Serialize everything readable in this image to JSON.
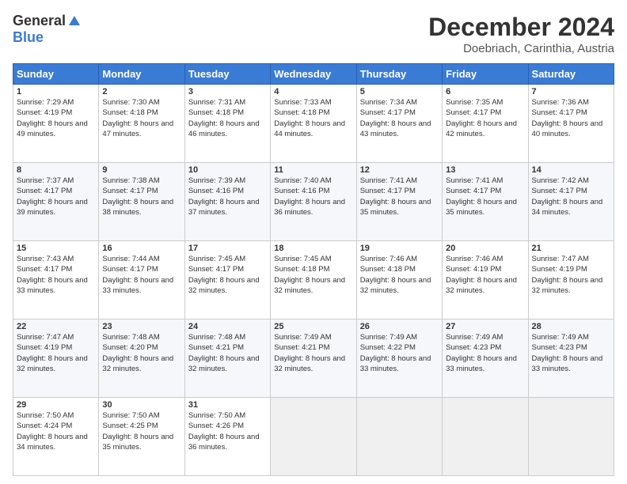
{
  "header": {
    "logo_general": "General",
    "logo_blue": "Blue",
    "month_title": "December 2024",
    "subtitle": "Doebriach, Carinthia, Austria"
  },
  "weekdays": [
    "Sunday",
    "Monday",
    "Tuesday",
    "Wednesday",
    "Thursday",
    "Friday",
    "Saturday"
  ],
  "weeks": [
    [
      {
        "day": "1",
        "sunrise": "Sunrise: 7:29 AM",
        "sunset": "Sunset: 4:19 PM",
        "daylight": "Daylight: 8 hours and 49 minutes."
      },
      {
        "day": "2",
        "sunrise": "Sunrise: 7:30 AM",
        "sunset": "Sunset: 4:18 PM",
        "daylight": "Daylight: 8 hours and 47 minutes."
      },
      {
        "day": "3",
        "sunrise": "Sunrise: 7:31 AM",
        "sunset": "Sunset: 4:18 PM",
        "daylight": "Daylight: 8 hours and 46 minutes."
      },
      {
        "day": "4",
        "sunrise": "Sunrise: 7:33 AM",
        "sunset": "Sunset: 4:18 PM",
        "daylight": "Daylight: 8 hours and 44 minutes."
      },
      {
        "day": "5",
        "sunrise": "Sunrise: 7:34 AM",
        "sunset": "Sunset: 4:17 PM",
        "daylight": "Daylight: 8 hours and 43 minutes."
      },
      {
        "day": "6",
        "sunrise": "Sunrise: 7:35 AM",
        "sunset": "Sunset: 4:17 PM",
        "daylight": "Daylight: 8 hours and 42 minutes."
      },
      {
        "day": "7",
        "sunrise": "Sunrise: 7:36 AM",
        "sunset": "Sunset: 4:17 PM",
        "daylight": "Daylight: 8 hours and 40 minutes."
      }
    ],
    [
      {
        "day": "8",
        "sunrise": "Sunrise: 7:37 AM",
        "sunset": "Sunset: 4:17 PM",
        "daylight": "Daylight: 8 hours and 39 minutes."
      },
      {
        "day": "9",
        "sunrise": "Sunrise: 7:38 AM",
        "sunset": "Sunset: 4:17 PM",
        "daylight": "Daylight: 8 hours and 38 minutes."
      },
      {
        "day": "10",
        "sunrise": "Sunrise: 7:39 AM",
        "sunset": "Sunset: 4:16 PM",
        "daylight": "Daylight: 8 hours and 37 minutes."
      },
      {
        "day": "11",
        "sunrise": "Sunrise: 7:40 AM",
        "sunset": "Sunset: 4:16 PM",
        "daylight": "Daylight: 8 hours and 36 minutes."
      },
      {
        "day": "12",
        "sunrise": "Sunrise: 7:41 AM",
        "sunset": "Sunset: 4:17 PM",
        "daylight": "Daylight: 8 hours and 35 minutes."
      },
      {
        "day": "13",
        "sunrise": "Sunrise: 7:41 AM",
        "sunset": "Sunset: 4:17 PM",
        "daylight": "Daylight: 8 hours and 35 minutes."
      },
      {
        "day": "14",
        "sunrise": "Sunrise: 7:42 AM",
        "sunset": "Sunset: 4:17 PM",
        "daylight": "Daylight: 8 hours and 34 minutes."
      }
    ],
    [
      {
        "day": "15",
        "sunrise": "Sunrise: 7:43 AM",
        "sunset": "Sunset: 4:17 PM",
        "daylight": "Daylight: 8 hours and 33 minutes."
      },
      {
        "day": "16",
        "sunrise": "Sunrise: 7:44 AM",
        "sunset": "Sunset: 4:17 PM",
        "daylight": "Daylight: 8 hours and 33 minutes."
      },
      {
        "day": "17",
        "sunrise": "Sunrise: 7:45 AM",
        "sunset": "Sunset: 4:17 PM",
        "daylight": "Daylight: 8 hours and 32 minutes."
      },
      {
        "day": "18",
        "sunrise": "Sunrise: 7:45 AM",
        "sunset": "Sunset: 4:18 PM",
        "daylight": "Daylight: 8 hours and 32 minutes."
      },
      {
        "day": "19",
        "sunrise": "Sunrise: 7:46 AM",
        "sunset": "Sunset: 4:18 PM",
        "daylight": "Daylight: 8 hours and 32 minutes."
      },
      {
        "day": "20",
        "sunrise": "Sunrise: 7:46 AM",
        "sunset": "Sunset: 4:19 PM",
        "daylight": "Daylight: 8 hours and 32 minutes."
      },
      {
        "day": "21",
        "sunrise": "Sunrise: 7:47 AM",
        "sunset": "Sunset: 4:19 PM",
        "daylight": "Daylight: 8 hours and 32 minutes."
      }
    ],
    [
      {
        "day": "22",
        "sunrise": "Sunrise: 7:47 AM",
        "sunset": "Sunset: 4:19 PM",
        "daylight": "Daylight: 8 hours and 32 minutes."
      },
      {
        "day": "23",
        "sunrise": "Sunrise: 7:48 AM",
        "sunset": "Sunset: 4:20 PM",
        "daylight": "Daylight: 8 hours and 32 minutes."
      },
      {
        "day": "24",
        "sunrise": "Sunrise: 7:48 AM",
        "sunset": "Sunset: 4:21 PM",
        "daylight": "Daylight: 8 hours and 32 minutes."
      },
      {
        "day": "25",
        "sunrise": "Sunrise: 7:49 AM",
        "sunset": "Sunset: 4:21 PM",
        "daylight": "Daylight: 8 hours and 32 minutes."
      },
      {
        "day": "26",
        "sunrise": "Sunrise: 7:49 AM",
        "sunset": "Sunset: 4:22 PM",
        "daylight": "Daylight: 8 hours and 33 minutes."
      },
      {
        "day": "27",
        "sunrise": "Sunrise: 7:49 AM",
        "sunset": "Sunset: 4:23 PM",
        "daylight": "Daylight: 8 hours and 33 minutes."
      },
      {
        "day": "28",
        "sunrise": "Sunrise: 7:49 AM",
        "sunset": "Sunset: 4:23 PM",
        "daylight": "Daylight: 8 hours and 33 minutes."
      }
    ],
    [
      {
        "day": "29",
        "sunrise": "Sunrise: 7:50 AM",
        "sunset": "Sunset: 4:24 PM",
        "daylight": "Daylight: 8 hours and 34 minutes."
      },
      {
        "day": "30",
        "sunrise": "Sunrise: 7:50 AM",
        "sunset": "Sunset: 4:25 PM",
        "daylight": "Daylight: 8 hours and 35 minutes."
      },
      {
        "day": "31",
        "sunrise": "Sunrise: 7:50 AM",
        "sunset": "Sunset: 4:26 PM",
        "daylight": "Daylight: 8 hours and 36 minutes."
      },
      null,
      null,
      null,
      null
    ]
  ]
}
